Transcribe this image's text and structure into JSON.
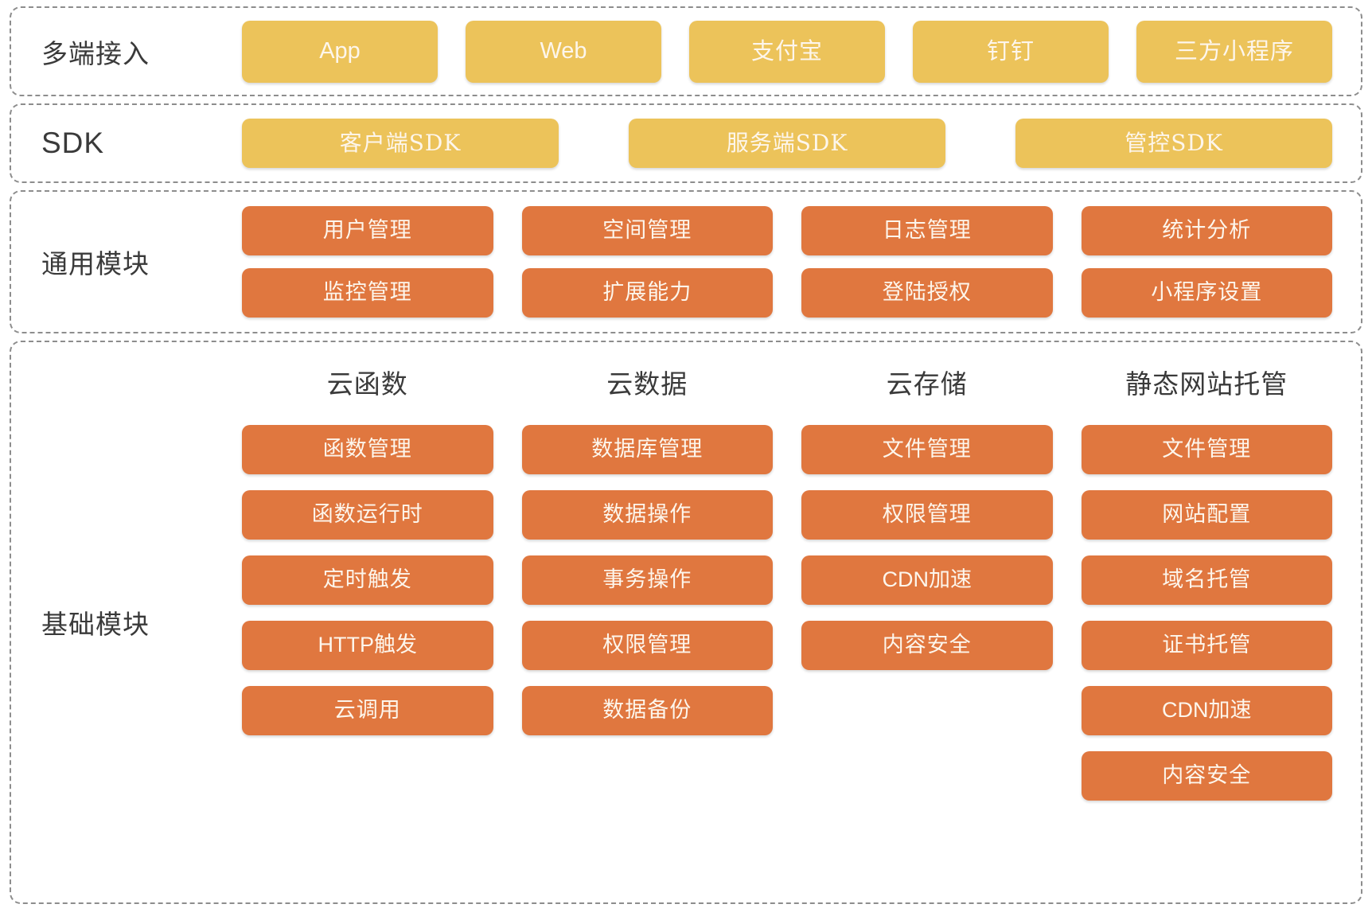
{
  "colors": {
    "amber": "#ecc35a",
    "orange": "#e0773f",
    "dashed_border": "#8d8d8d",
    "label_text": "#3a3a3a",
    "box_text": "#fdf6ec",
    "background": "#ffffff"
  },
  "layers": {
    "access": {
      "label": "多端接入",
      "items": [
        "App",
        "Web",
        "支付宝",
        "钉钉",
        "三方小程序"
      ]
    },
    "sdk": {
      "label": "SDK",
      "items": [
        "客户端SDK",
        "服务端SDK",
        "管控SDK"
      ]
    },
    "common": {
      "label": "通用模块",
      "items": [
        "用户管理",
        "空间管理",
        "日志管理",
        "统计分析",
        "监控管理",
        "扩展能力",
        "登陆授权",
        "小程序设置"
      ]
    },
    "base": {
      "label": "基础模块",
      "columns": [
        {
          "title": "云函数",
          "items": [
            "函数管理",
            "函数运行时",
            "定时触发",
            "HTTP触发",
            "云调用"
          ]
        },
        {
          "title": "云数据",
          "items": [
            "数据库管理",
            "数据操作",
            "事务操作",
            "权限管理",
            "数据备份"
          ]
        },
        {
          "title": "云存储",
          "items": [
            "文件管理",
            "权限管理",
            "CDN加速",
            "内容安全"
          ]
        },
        {
          "title": "静态网站托管",
          "items": [
            "文件管理",
            "网站配置",
            "域名托管",
            "证书托管",
            "CDN加速",
            "内容安全"
          ]
        }
      ]
    }
  }
}
